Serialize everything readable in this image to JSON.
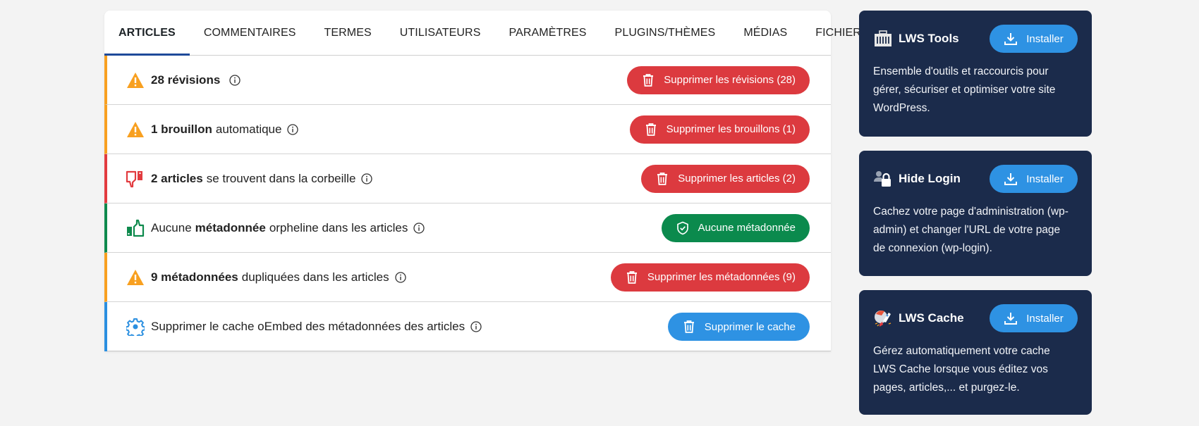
{
  "tabs": [
    {
      "label": "ARTICLES",
      "active": true
    },
    {
      "label": "COMMENTAIRES"
    },
    {
      "label": "TERMES"
    },
    {
      "label": "UTILISATEURS"
    },
    {
      "label": "PARAMÈTRES"
    },
    {
      "label": "PLUGINS/THÈMES"
    },
    {
      "label": "MÉDIAS"
    },
    {
      "label": "FICHIERS"
    }
  ],
  "rows": [
    {
      "status": "warning",
      "icon": "warning-icon",
      "bold": "28 révisions",
      "rest": "",
      "button": {
        "label": "Supprimer les révisions (28)",
        "icon": "trash-icon",
        "color": "#dc3a3f"
      }
    },
    {
      "status": "warning",
      "icon": "warning-icon",
      "bold": "1 brouillon",
      "rest": "automatique",
      "button": {
        "label": "Supprimer les brouillons (1)",
        "icon": "trash-icon",
        "color": "#dc3a3f"
      }
    },
    {
      "status": "error",
      "icon": "thumbs-down-icon",
      "bold": "2 articles",
      "rest": "se trouvent dans la corbeille",
      "button": {
        "label": "Supprimer les articles (2)",
        "icon": "trash-icon",
        "color": "#dc3a3f"
      }
    },
    {
      "status": "ok",
      "icon": "thumbs-up-icon",
      "pre": "Aucune",
      "bold": "métadonnée",
      "rest": "orpheline dans les articles",
      "button": {
        "label": "Aucune métadonnée",
        "icon": "shield-check-icon",
        "color": "#0b8a4d"
      }
    },
    {
      "status": "warning",
      "icon": "warning-icon",
      "bold": "9 métadonnées",
      "rest": "dupliquées dans les articles",
      "button": {
        "label": "Supprimer les métadonnées (9)",
        "icon": "trash-icon",
        "color": "#dc3a3f"
      }
    },
    {
      "status": "info",
      "icon": "gear-icon",
      "bold": "",
      "rest": "Supprimer le cache oEmbed des métadonnées des articles",
      "button": {
        "label": "Supprimer le cache",
        "icon": "trash-icon",
        "color": "#2e92e3"
      }
    }
  ],
  "plugins": [
    {
      "name": "LWS Tools",
      "icon": "toolbox-icon",
      "button": "Installer",
      "description": "Ensemble d'outils et raccourcis pour gérer, sécuriser et optimiser votre site WordPress."
    },
    {
      "name": "Hide Login",
      "icon": "user-lock-icon",
      "button": "Installer",
      "description": "Cachez votre page d'administration (wp-admin) et changer l'URL de votre page de connexion (wp-login)."
    },
    {
      "name": "LWS Cache",
      "icon": "rocket-icon",
      "button": "Installer",
      "description": "Gérez automatiquement votre cache LWS Cache lorsque vous éditez vos pages, articles,... et purgez-le."
    }
  ],
  "colors": {
    "warning": "#f8a020",
    "error": "#e23b3f",
    "ok": "#0e8a4d",
    "info": "#2b8fe0",
    "tab_active_underline": "#1e4a9a",
    "card_bg": "#1b2b4b"
  }
}
